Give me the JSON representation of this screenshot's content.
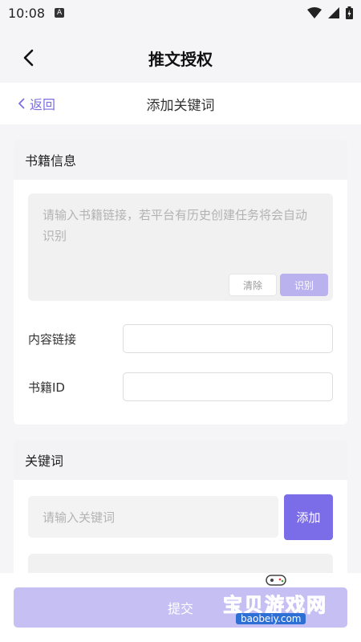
{
  "status": {
    "time": "10:08",
    "notif_icon": "A"
  },
  "app": {
    "title": "推文授权"
  },
  "sub": {
    "back_label": "返回",
    "title": "添加关键词"
  },
  "book": {
    "section_title": "书籍信息",
    "link_placeholder": "请输入书籍链接，若平台有历史创建任务将会自动识别",
    "clear_label": "清除",
    "recognize_label": "识别",
    "content_link_label": "内容链接",
    "content_link_value": "",
    "book_id_label": "书籍ID",
    "book_id_value": ""
  },
  "keywords": {
    "section_title": "关键词",
    "input_placeholder": "请输入关键词",
    "add_label": "添加"
  },
  "submit_label": "提交",
  "watermark": {
    "brand": "宝贝游戏网",
    "url": "baobeiy.com"
  },
  "colors": {
    "accent": "#7b6ce8",
    "accent_disabled": "#c6bff4",
    "link": "#7b6fe0"
  }
}
